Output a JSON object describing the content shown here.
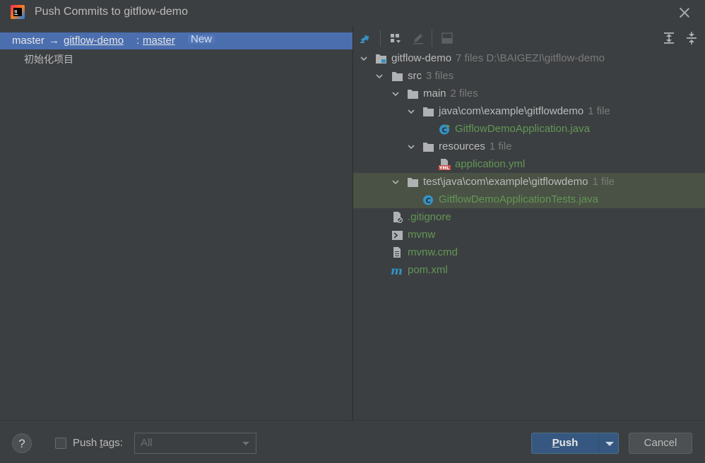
{
  "window": {
    "title": "Push Commits to gitflow-demo"
  },
  "left": {
    "branch": {
      "local": "master",
      "arrow": "→",
      "remote": "gitflow-demo",
      "sep": ":",
      "remote_branch": "master",
      "badge": "New"
    },
    "commits": [
      "初始化项目"
    ]
  },
  "tree": {
    "root": {
      "name": "gitflow-demo",
      "meta": "7 files  D:\\BAIGEZI\\gitflow-demo"
    },
    "src": {
      "name": "src",
      "meta": "3 files"
    },
    "main": {
      "name": "main",
      "meta": "2 files"
    },
    "java": {
      "name": "java\\com\\example\\gitflowdemo",
      "meta": "1 file"
    },
    "app_java": {
      "name": "GitflowDemoApplication.java"
    },
    "resources": {
      "name": "resources",
      "meta": "1 file"
    },
    "app_yml": {
      "name": "application.yml"
    },
    "test": {
      "name": "test\\java\\com\\example\\gitflowdemo",
      "meta": "1 file"
    },
    "test_java": {
      "name": "GitflowDemoApplicationTests.java"
    },
    "gitignore": {
      "name": ".gitignore"
    },
    "mvnw": {
      "name": "mvnw"
    },
    "mvnw_cmd": {
      "name": "mvnw.cmd"
    },
    "pom": {
      "name": "pom.xml"
    }
  },
  "footer": {
    "help": "?",
    "push_tags_prefix": "Push ",
    "push_tags_mnemonic": "t",
    "push_tags_suffix": "ags:",
    "tags_select": "All",
    "push_mnemonic": "P",
    "push_rest": "ush",
    "cancel": "Cancel"
  },
  "colors": {
    "selection": "#4b6eaf",
    "added_file": "#629755",
    "background": "#3c3f41",
    "highlight_row": "#4a5245"
  }
}
